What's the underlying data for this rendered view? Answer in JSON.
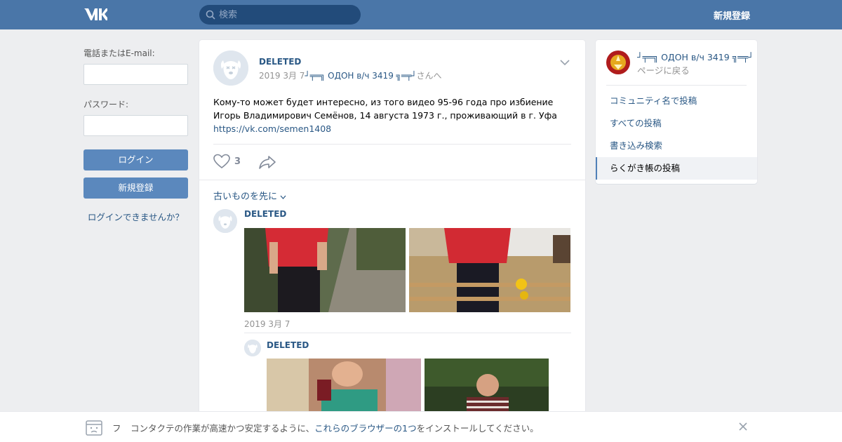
{
  "header": {
    "logo_icon": "vk-logo-icon",
    "search_placeholder": "検索",
    "register_label": "新規登録"
  },
  "login": {
    "phone_label": "電話またはE-mail:",
    "password_label": "パスワード:",
    "login_button": "ログイン",
    "register_button": "新規登録",
    "forgot_link": "ログインできませんか？"
  },
  "post": {
    "author": "DELETED",
    "date": "2019 3月 7",
    "wall_owner": "┘╤═╗ ОДОН в/ч 3419 ╗═╤┘",
    "wall_suffix": "さんへ",
    "text_line1": "Кому-то может будет интересно, из того видео 95-96 года про избиение",
    "text_line2": "Игорь Владимирович Семёнов, 14 августа 1973 г., проживающий в г. Уфа",
    "link": "https://vk.com/semen1408",
    "likes": "3",
    "sort_label": "古いものを先に"
  },
  "comments": [
    {
      "author": "DELETED",
      "date": "2019 3月 7"
    },
    {
      "author": "DELETED"
    }
  ],
  "sidebar": {
    "community_name": "┘╤═╗ ОДОН в/ч 3419 ╗═╤┘",
    "back_label": "ページに戻る",
    "items": [
      {
        "label": "コミュニティ名で投稿"
      },
      {
        "label": "すべての投稿"
      },
      {
        "label": "書き込み検索"
      },
      {
        "label": "らくがき帳の投稿"
      }
    ]
  },
  "browser_bar": {
    "f_label": "フ",
    "text_before": "コンタクテの作業が高速かつ安定するように、",
    "link": "これらのブラウザーの1つ",
    "text_after": "をインストールしてください。"
  },
  "colors": {
    "header_bg": "#4a76a8",
    "link": "#2a5885",
    "button": "#5b88bd",
    "page_bg": "#edeef0"
  }
}
